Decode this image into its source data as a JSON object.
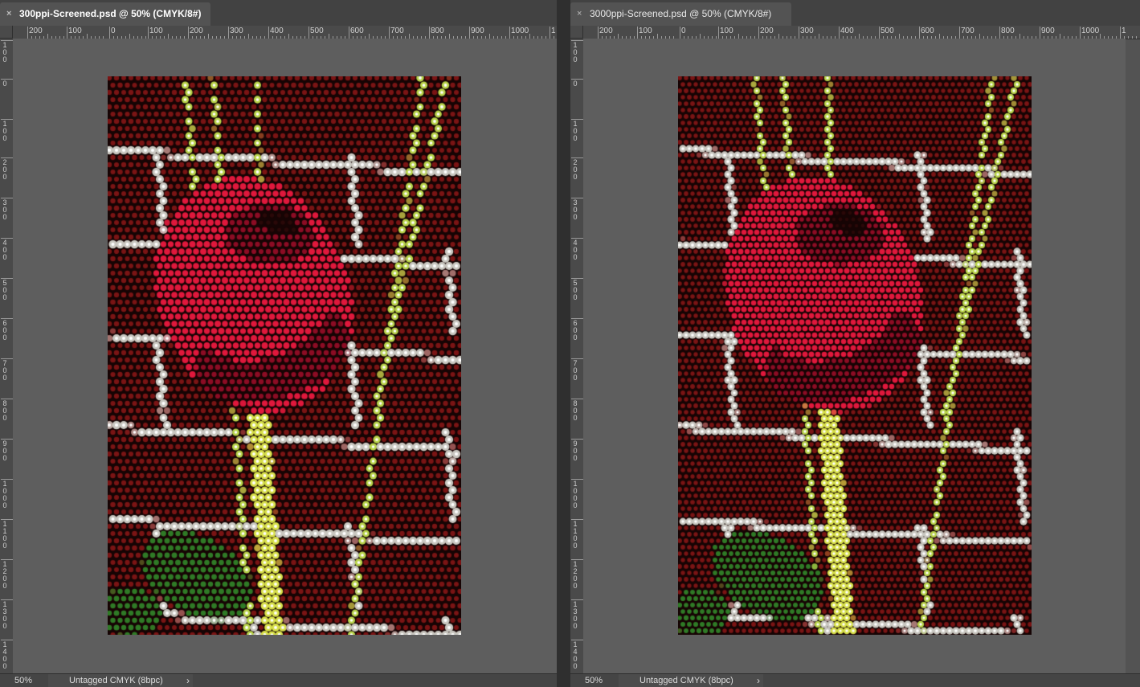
{
  "documents": [
    {
      "tab_title": "300ppi-Screened.psd @ 50% (CMYK/8#)",
      "close_glyph": "×",
      "ruler_h_labels": [
        "200",
        "100",
        "0",
        "100",
        "200",
        "300",
        "400",
        "500",
        "600",
        "700",
        "800",
        "900",
        "1000",
        "1"
      ],
      "ruler_v_labels": [
        "100",
        "0",
        "100",
        "200",
        "300",
        "400",
        "500",
        "600",
        "700",
        "800",
        "900",
        "1000",
        "1100",
        "1200",
        "1300",
        "1400"
      ],
      "status_zoom": "50%",
      "status_profile": "Untagged CMYK (8bpc)",
      "status_arrow": "›"
    },
    {
      "tab_title": "3000ppi-Screened.psd @ 50% (CMYK/8#)",
      "close_glyph": "×",
      "ruler_h_labels": [
        "200",
        "100",
        "0",
        "100",
        "200",
        "300",
        "400",
        "500",
        "600",
        "700",
        "800",
        "900",
        "1000",
        "1"
      ],
      "ruler_v_labels": [
        "100",
        "0",
        "100",
        "200",
        "300",
        "400",
        "500",
        "600",
        "700",
        "800",
        "900",
        "1000",
        "1100",
        "1200",
        "1300",
        "1400"
      ],
      "status_zoom": "50%",
      "status_profile": "Untagged CMYK (8bpc)",
      "status_arrow": "›"
    }
  ],
  "colors": {
    "brick": "#7a1414",
    "mortar": "#c9c7c0",
    "rose": "#e0183c",
    "rose_dark": "#8c0c24",
    "stem": "#d8e04a",
    "leaf": "#2f7a26",
    "canvas_bg": "#5e5e5e"
  }
}
